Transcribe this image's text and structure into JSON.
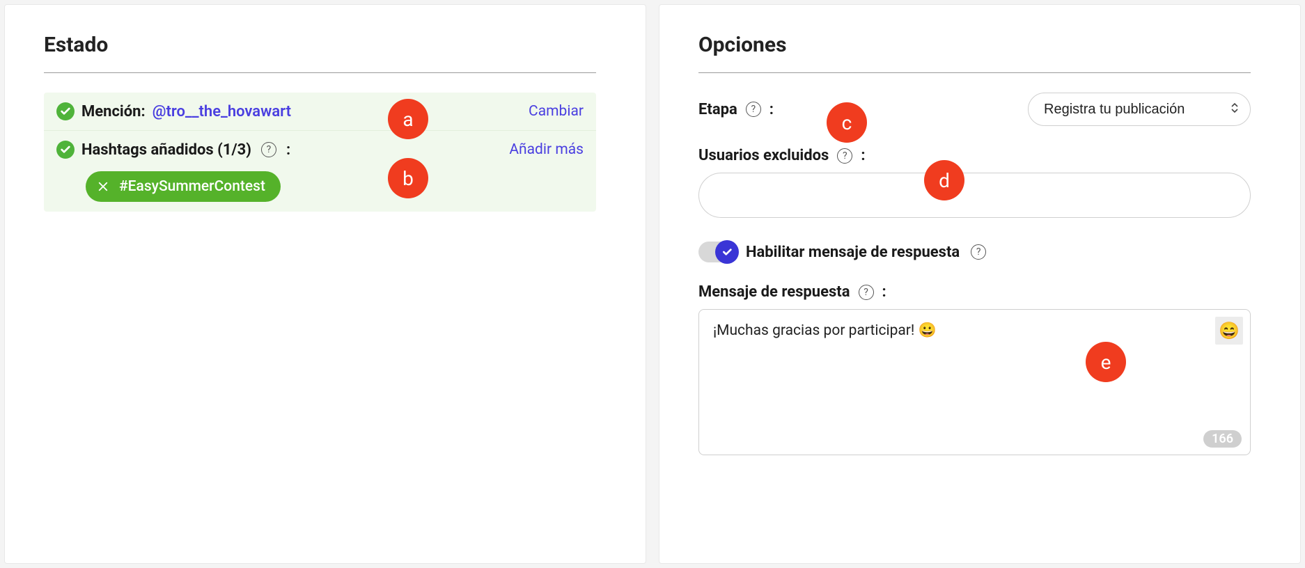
{
  "left": {
    "title": "Estado",
    "mention": {
      "label": "Mención: ",
      "value": "@tro__the_hovawart",
      "action": "Cambiar"
    },
    "hashtags": {
      "label": "Hashtags añadidos (1/3)",
      "colon": ":",
      "action": "Añadir más",
      "items": [
        "#EasySummerContest"
      ]
    }
  },
  "right": {
    "title": "Opciones",
    "stage": {
      "label": "Etapa",
      "colon": ":",
      "selected": "Registra tu publicación"
    },
    "excluded": {
      "label": "Usuarios excluidos",
      "colon": ":",
      "value": ""
    },
    "toggle": {
      "label": "Habilitar mensaje de respuesta",
      "on": true
    },
    "reply": {
      "label": "Mensaje de respuesta",
      "colon": ":",
      "value": "¡Muchas gracias por participar! 😀",
      "remaining": "166"
    }
  },
  "annotations": {
    "a": "a",
    "b": "b",
    "c": "c",
    "d": "d",
    "e": "e"
  }
}
